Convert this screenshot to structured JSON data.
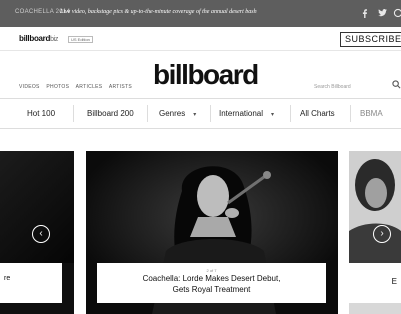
{
  "promo": {
    "tag": "COACHELLA 2014",
    "headline": "Live video, backstage pics & up-to-the-minute coverage of the annual desert bash"
  },
  "brand_strip": {
    "biz_logo_main": "billboard",
    "biz_logo_suffix": "biz",
    "edition": "US Edition",
    "subscribe": "SUBSCRIBE"
  },
  "header": {
    "top_links": [
      "VIDEOS",
      "PHOTOS",
      "ARTICLES",
      "ARTISTS"
    ],
    "logo": "billboard",
    "search_placeholder": "Search Billboard"
  },
  "nav": {
    "items": [
      {
        "label": "Hot 100"
      },
      {
        "label": "Billboard 200"
      },
      {
        "label": "Genres"
      },
      {
        "label": "International"
      },
      {
        "label": "All Charts"
      },
      {
        "label": "BBMA"
      }
    ]
  },
  "carousel": {
    "left_caption": "re",
    "main_pager": "2 of 7",
    "main_title_line1": "Coachella: Lorde Makes Desert Debut,",
    "main_title_line2": "Gets Royal Treatment",
    "right_caption": "E"
  },
  "colors": {
    "promo_bg": "#5e5e5e",
    "slide_bg": "#151515"
  }
}
